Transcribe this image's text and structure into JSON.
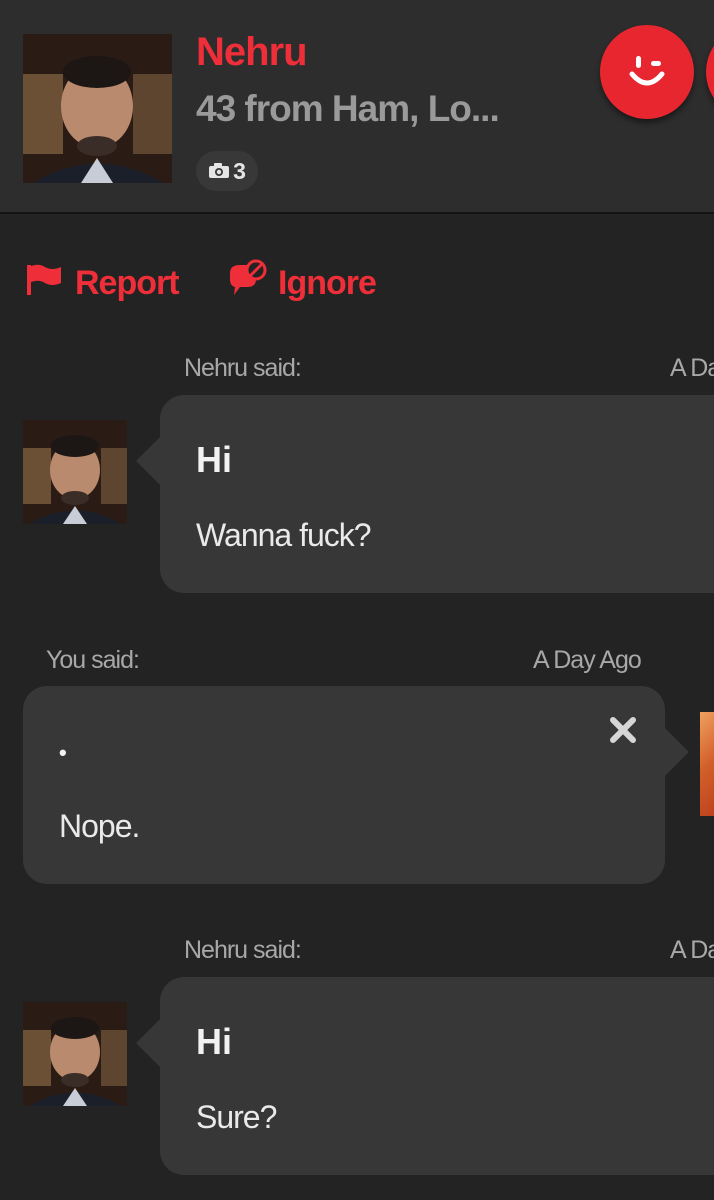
{
  "profile": {
    "name": "Nehru",
    "subtitle": "43 from Ham, Lo...",
    "photo_count": "3"
  },
  "actions": {
    "report_label": "Report",
    "ignore_label": "Ignore"
  },
  "messages": [
    {
      "sender_label": "Nehru said:",
      "time": "A Da",
      "title": "Hi",
      "body": "Wanna fuck?"
    },
    {
      "sender_label": "You said:",
      "time": "A Day Ago",
      "title": "•",
      "body": "Nope."
    },
    {
      "sender_label": "Nehru said:",
      "time": "A Da",
      "title": "Hi",
      "body": "Sure?"
    }
  ],
  "colors": {
    "accent": "#ee2e38",
    "background": "#232323",
    "header_background": "#2d2d2d",
    "bubble_background": "#373737"
  },
  "icons": {
    "wink_button": "wink-smiley-icon",
    "report": "flag-icon",
    "ignore": "blocked-speech-bubble-icon",
    "photo_count": "camera-icon",
    "delete": "close-x-icon"
  }
}
